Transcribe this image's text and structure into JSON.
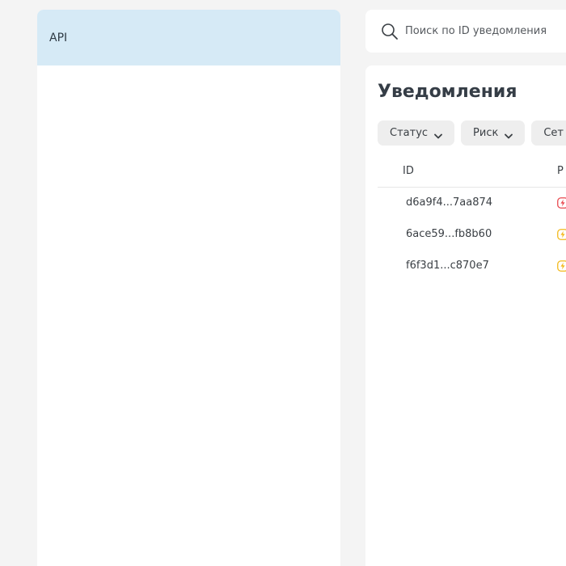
{
  "sidebar": {
    "items": [
      {
        "label": "API",
        "active": true
      }
    ]
  },
  "search": {
    "placeholder": "Поиск по ID уведомления",
    "icon": "search-icon"
  },
  "main": {
    "title": "Уведомления",
    "filters": [
      {
        "label": "Статус",
        "icon": "chevron-down-icon"
      },
      {
        "label": "Риск",
        "icon": "chevron-down-icon"
      },
      {
        "label": "Сет",
        "icon": "chevron-down-icon"
      }
    ],
    "table": {
      "columns": [
        "ID",
        "Р"
      ],
      "rows": [
        {
          "id": "d6a9f4...7aa874",
          "risk_color": "#e8484f"
        },
        {
          "id": "6ace59...fb8b60",
          "risk_color": "#f3b91c"
        },
        {
          "id": "f6f3d1...c870e7",
          "risk_color": "#f3b91c"
        }
      ]
    }
  },
  "colors": {
    "accent_active": "#d6eaf6",
    "background": "#f4f4f4",
    "panel": "#ffffff",
    "filter_bg": "#eeeeee"
  }
}
